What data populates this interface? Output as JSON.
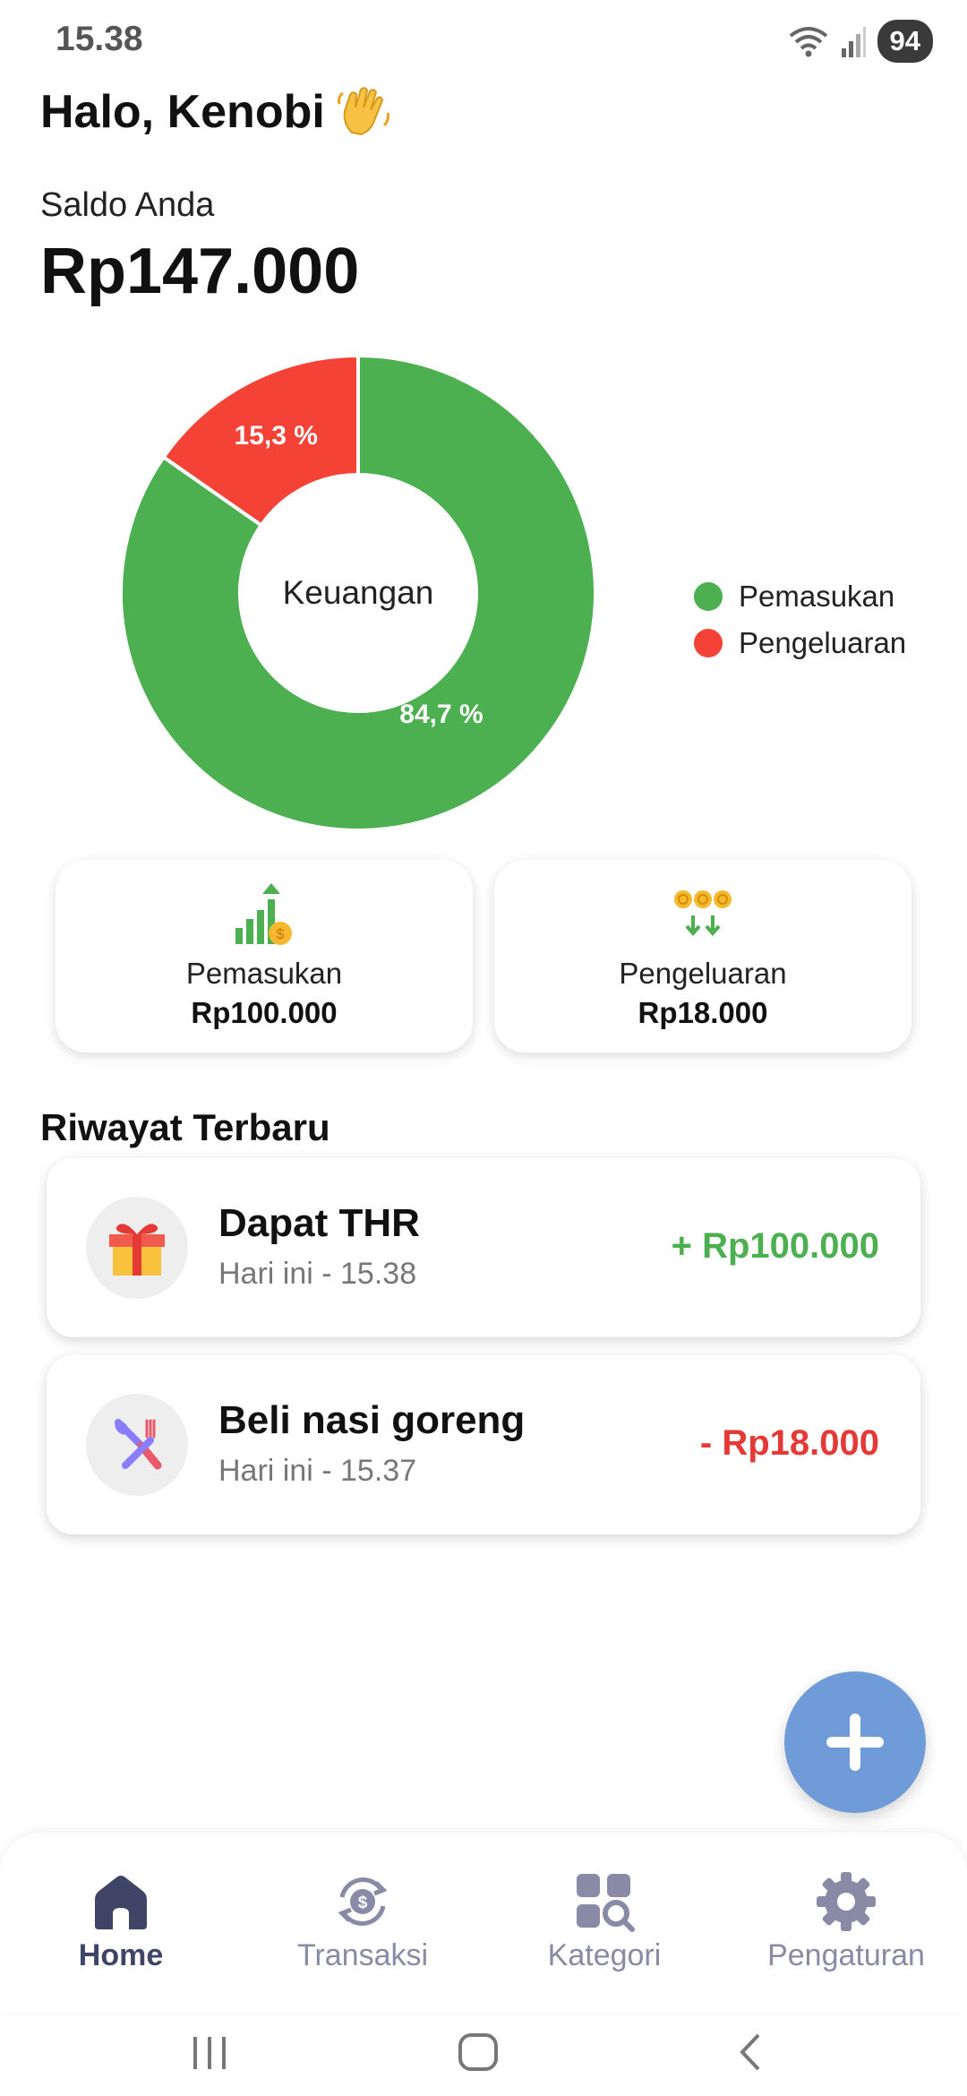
{
  "status_bar": {
    "time": "15.38",
    "battery": "94"
  },
  "header": {
    "greeting": "Halo, Kenobi"
  },
  "balance": {
    "label": "Saldo Anda",
    "value": "Rp147.000"
  },
  "chart_data": {
    "type": "pie",
    "center_label": "Keuangan",
    "categories": [
      "Pemasukan",
      "Pengeluaran"
    ],
    "values": [
      84.7,
      15.3
    ],
    "value_labels": [
      "84,7 %",
      "15,3 %"
    ],
    "colors": [
      "#4caf50",
      "#f44336"
    ],
    "legend_placement": "right"
  },
  "summary": {
    "income": {
      "label": "Pemasukan",
      "value": "Rp100.000"
    },
    "expense": {
      "label": "Pengeluaran",
      "value": "Rp18.000"
    }
  },
  "recent": {
    "title": "Riwayat Terbaru",
    "items": [
      {
        "title": "Dapat THR",
        "time": "Hari ini - 15.38",
        "amount": "+ Rp100.000",
        "color": "#4caf50",
        "icon": "gift-icon"
      },
      {
        "title": "Beli nasi goreng",
        "time": "Hari ini - 15.37",
        "amount": "- Rp18.000",
        "color": "#e53935",
        "icon": "food-icon"
      }
    ]
  },
  "nav": {
    "items": [
      {
        "label": "Home",
        "icon": "home-icon",
        "active": true
      },
      {
        "label": "Transaksi",
        "icon": "transaction-icon",
        "active": false
      },
      {
        "label": "Kategori",
        "icon": "category-icon",
        "active": false
      },
      {
        "label": "Pengaturan",
        "icon": "settings-icon",
        "active": false
      }
    ]
  }
}
